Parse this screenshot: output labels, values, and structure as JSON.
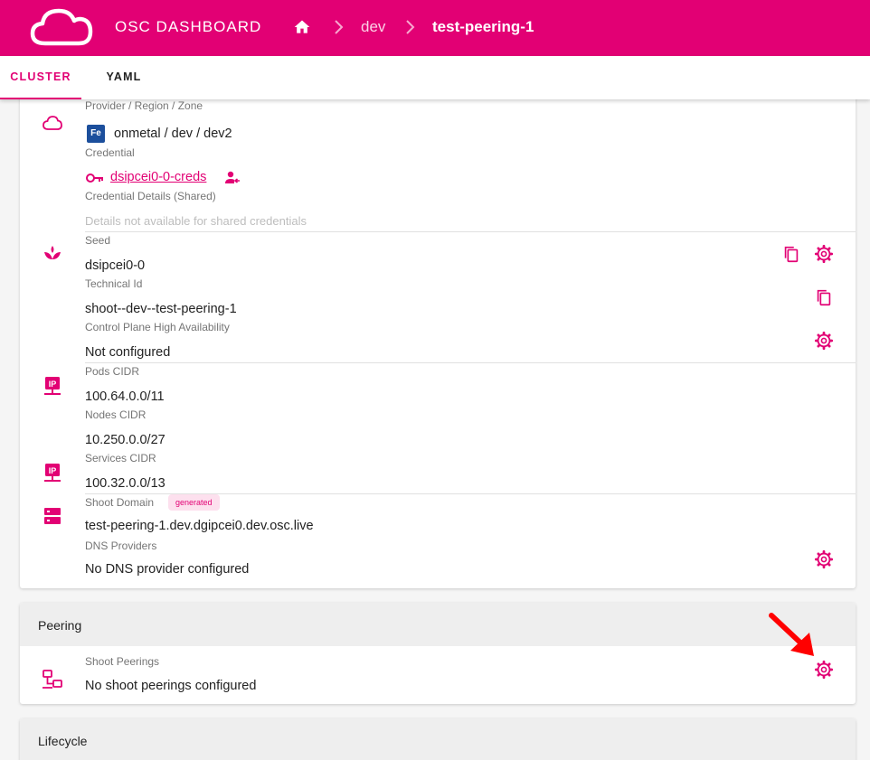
{
  "header": {
    "app_title": "OSC DASHBOARD",
    "breadcrumb": [
      "dev",
      "test-peering-1"
    ]
  },
  "tabs": [
    {
      "label": "CLUSTER",
      "active": true
    },
    {
      "label": "YAML",
      "active": false
    }
  ],
  "infrastructure": {
    "provider_label": "Provider / Region / Zone",
    "provider_logo_text": "Fe",
    "provider_value": "onmetal / dev / dev2",
    "credential_label": "Credential",
    "credential_value": "dsipcei0-0-creds",
    "credential_details_label": "Credential Details (Shared)",
    "credential_details_value": "Details not available for shared credentials"
  },
  "seed": {
    "seed_label": "Seed",
    "seed_value": "dsipcei0-0",
    "technical_id_label": "Technical Id",
    "technical_id_value": "shoot--dev--test-peering-1",
    "ha_label": "Control Plane High Availability",
    "ha_value": "Not configured"
  },
  "network": {
    "pods_label": "Pods CIDR",
    "pods_value": "100.64.0.0/11",
    "nodes_label": "Nodes CIDR",
    "nodes_value": "10.250.0.0/27",
    "services_label": "Services CIDR",
    "services_value": "100.32.0.0/13"
  },
  "dns": {
    "domain_label": "Shoot Domain",
    "domain_badge": "generated",
    "domain_value": "test-peering-1.dev.dgipcei0.dev.osc.live",
    "providers_label": "DNS Providers",
    "providers_value": "No DNS provider configured"
  },
  "peering": {
    "title": "Peering",
    "label": "Shoot Peerings",
    "value": "No shoot peerings configured"
  },
  "lifecycle": {
    "title": "Lifecycle"
  },
  "colors": {
    "brand": "#e20074",
    "annotation_arrow": "#ff0000"
  },
  "icons": [
    "cloud-logo-icon",
    "home-icon",
    "chevron-right-icon",
    "cloud-icon",
    "key-icon",
    "account-arrow-icon",
    "seed-icon",
    "copy-icon",
    "gear-icon",
    "ip-network-icon",
    "dns-server-icon",
    "peering-network-icon"
  ]
}
